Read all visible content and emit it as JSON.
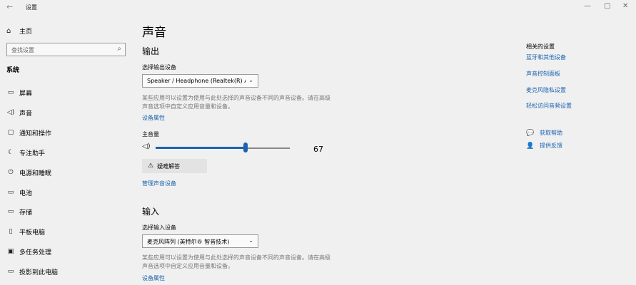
{
  "window": {
    "title": "设置",
    "back": "←",
    "minimize": "—",
    "maximize": "▢",
    "close": "✕"
  },
  "sidebar": {
    "home_label": "主页",
    "search_placeholder": "查找设置",
    "section_title": "系统",
    "items": [
      {
        "label": "屏幕",
        "icon": "display-icon",
        "glyph": "▭"
      },
      {
        "label": "声音",
        "icon": "speaker-icon",
        "glyph": "🔈"
      },
      {
        "label": "通知和操作",
        "icon": "notification-icon",
        "glyph": "▢"
      },
      {
        "label": "专注助手",
        "icon": "moon-icon",
        "glyph": "☾"
      },
      {
        "label": "电源和睡眠",
        "icon": "power-icon",
        "glyph": "⏻"
      },
      {
        "label": "电池",
        "icon": "battery-icon",
        "glyph": "▭"
      },
      {
        "label": "存储",
        "icon": "storage-icon",
        "glyph": "▭"
      },
      {
        "label": "平板电脑",
        "icon": "tablet-icon",
        "glyph": "▯"
      },
      {
        "label": "多任务处理",
        "icon": "multitask-icon",
        "glyph": "▣"
      },
      {
        "label": "投影到此电脑",
        "icon": "project-icon",
        "glyph": "▭"
      }
    ]
  },
  "main": {
    "title": "声音",
    "output": {
      "heading": "输出",
      "select_label": "选择输出设备",
      "device": "Speaker / Headphone (Realtek(R) Au...",
      "description": "某些应用可以设置为使用与此处选择的声音设备不同的声音设备。请在高级声音选项中自定义应用音量和设备。",
      "device_props_link": "设备属性",
      "master_volume_label": "主音量",
      "volume": 67,
      "volume_display": "67",
      "troubleshoot_label": "疑难解答",
      "manage_link": "管理声音设备"
    },
    "input": {
      "heading": "输入",
      "select_label": "选择输入设备",
      "device": "麦克风阵列 (英特尔® 智音技术)",
      "description": "某些应用可以设置为使用与此处选择的声音设备不同的声音设备。请在高级声音选项中自定义应用音量和设备。",
      "device_props_link": "设备属性"
    }
  },
  "related": {
    "title": "相关的设置",
    "links": [
      "蓝牙和其他设备",
      "声音控制面板",
      "麦克风隐私设置",
      "轻松访问音频设置"
    ],
    "help_label": "获取帮助",
    "feedback_label": "提供反馈"
  },
  "colors": {
    "accent": "#1a63b0",
    "background": "#f0f0f0"
  }
}
